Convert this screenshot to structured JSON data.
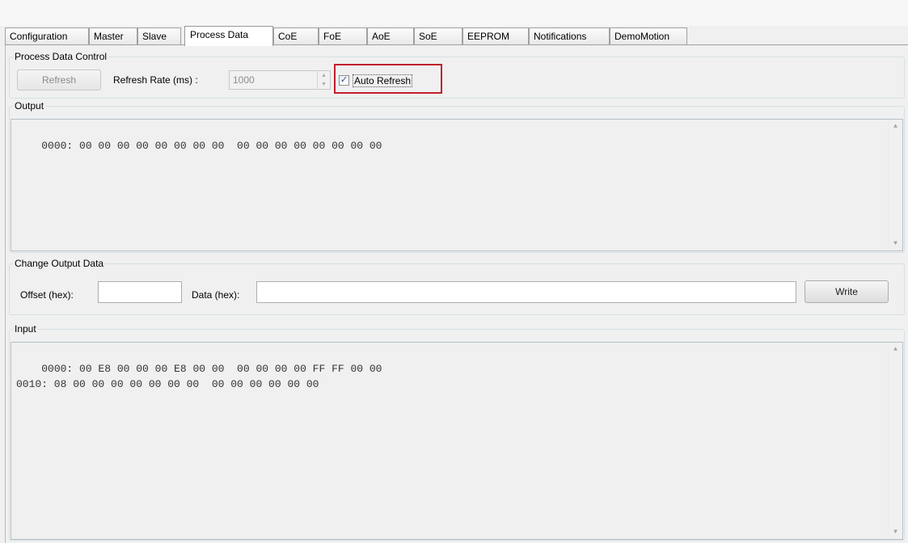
{
  "tabs": [
    {
      "label": "Configuration",
      "active": false
    },
    {
      "label": "Master",
      "active": false
    },
    {
      "label": "Slave",
      "active": false
    },
    {
      "label": "Process Data",
      "active": true
    },
    {
      "label": "CoE",
      "active": false
    },
    {
      "label": "FoE",
      "active": false
    },
    {
      "label": "AoE",
      "active": false
    },
    {
      "label": "SoE",
      "active": false
    },
    {
      "label": "EEPROM",
      "active": false
    },
    {
      "label": "Notifications",
      "active": false
    },
    {
      "label": "DemoMotion",
      "active": false
    }
  ],
  "process_data_control": {
    "title": "Process Data Control",
    "refresh_button": "Refresh",
    "refresh_rate_label": "Refresh Rate (ms) :",
    "refresh_rate_value": "1000",
    "auto_refresh_label": "Auto Refresh",
    "auto_refresh_checked": true
  },
  "output": {
    "title": "Output",
    "text": "0000: 00 00 00 00 00 00 00 00  00 00 00 00 00 00 00 00"
  },
  "change_output": {
    "title": "Change Output Data",
    "offset_label": "Offset (hex):",
    "offset_value": "",
    "data_label": "Data (hex):",
    "data_value": "",
    "write_button": "Write"
  },
  "input": {
    "title": "Input",
    "text": "0000: 00 E8 00 00 00 E8 00 00  00 00 00 00 FF FF 00 00\n0010: 08 00 00 00 00 00 00 00  00 00 00 00 00 00"
  },
  "colors": {
    "highlight": "#c11f2c",
    "background": "#f0f0f0"
  },
  "icons": {
    "checkbox": "checkmark-icon",
    "spin_up": "chevron-up-icon",
    "spin_down": "chevron-down-icon",
    "scroll_up": "scroll-up-arrow-icon",
    "scroll_down": "scroll-down-arrow-icon"
  }
}
